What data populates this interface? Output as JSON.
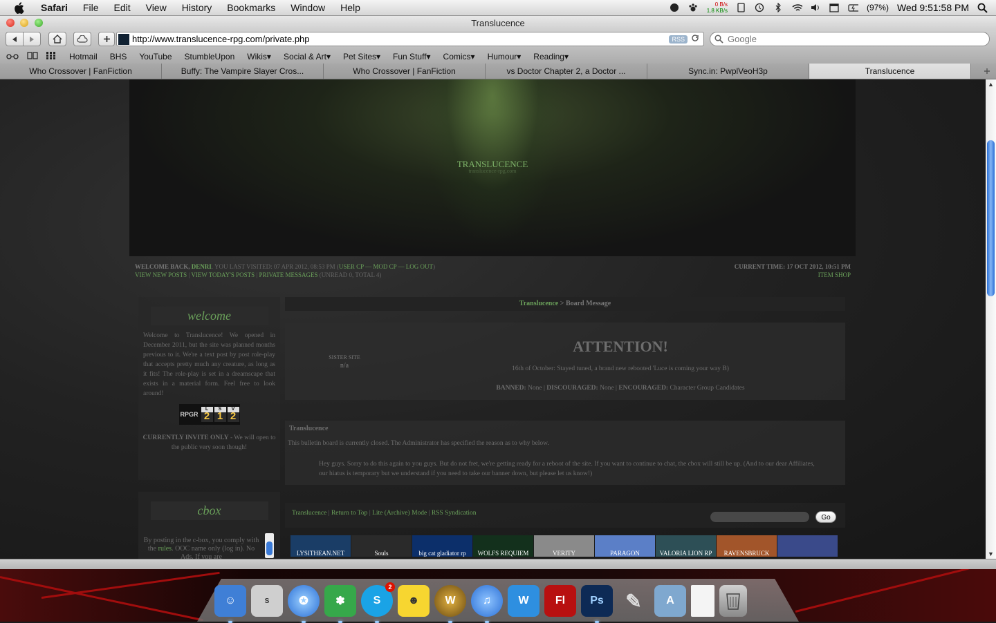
{
  "menubar": {
    "app": "Safari",
    "items": [
      "File",
      "Edit",
      "View",
      "History",
      "Bookmarks",
      "Window",
      "Help"
    ],
    "net_up": "0 B/s",
    "net_down": "1.8 KB/s",
    "battery": "(97%)",
    "clock": "Wed 9:51:58 PM"
  },
  "window": {
    "title": "Translucence"
  },
  "toolbar": {
    "url": "http://www.translucence-rpg.com/private.php",
    "rss_label": "RSS",
    "search_placeholder": "Google"
  },
  "bookmarks": [
    "Hotmail",
    "BHS",
    "YouTube",
    "StumbleUpon",
    "Wikis▾",
    "Social & Art▾",
    "Pet Sites▾",
    "Fun Stuff▾",
    "Comics▾",
    "Humour▾",
    "Reading▾"
  ],
  "tabs": [
    {
      "title": "Who Crossover | FanFiction"
    },
    {
      "title": "Buffy: The Vampire Slayer Cros..."
    },
    {
      "title": "Who Crossover | FanFiction"
    },
    {
      "title": "vs Doctor Chapter 2, a Doctor ..."
    },
    {
      "title": "Sync.in: PwplVeoH3p"
    },
    {
      "title": "Translucence"
    }
  ],
  "banner": {
    "name": "TRANSLUCENCE",
    "sub": "translucence-rpg.com"
  },
  "userbar": {
    "welcome_prefix": "WELCOME BACK,",
    "username": "DENRI",
    "visited": ". YOU LAST VISITED: 07 APR 2012, 08:53 PM (",
    "user_cp": "USER CP",
    "mod_cp": "MOD CP",
    "log_out": "LOG OUT",
    "close_paren": ")",
    "sep": " — ",
    "view_new": "VIEW NEW POSTS",
    "view_today": "VIEW TODAY'S POSTS",
    "pms": "PRIVATE MESSAGES",
    "pm_counts": " (UNREAD 0, TOTAL 4)",
    "pipe": " | ",
    "current_time": "CURRENT TIME: 17 OCT 2012, 10:51 PM",
    "item_shop": "ITEM SHOP"
  },
  "sidebar": {
    "welcome_title": "welcome",
    "welcome_text": "Welcome to Translucence! We opened in December 2011, but the site was planned months previous to it. We're a text post by post role-play that accepts pretty much any creature, as long as it fits! The role-play is set in a dreamscape that exists in a material form. Feel free to look around!",
    "rpgr_logo": "RPGR",
    "rpgr_digits": [
      {
        "k": "L",
        "v": "2"
      },
      {
        "k": "S",
        "v": "1"
      },
      {
        "k": "V",
        "v": "2"
      }
    ],
    "invite_bold": "CURRENTLY INVITE ONLY",
    "invite_rest": " - We will open to the public very soon though!",
    "cbox_title": "cbox",
    "cbox_text_1": "By posting in the c-box, you comply with the ",
    "cbox_rules": "rules",
    "cbox_text_2": ". OOC name only (log in). No Ads. If you are"
  },
  "breadcrumb": {
    "link": "Translucence",
    "rest": " > Board Message"
  },
  "attention": {
    "sister_label": "SISTER SITE",
    "sister_value": "n/a",
    "heading": "ATTENTION!",
    "message": "16th of October: Stayed tuned, a brand new rebooted 'Luce is coming your way B)",
    "banned_label": "BANNED:",
    "banned_value": " None | ",
    "discouraged_label": "DISCOURAGED:",
    "discouraged_value": " None | ",
    "encouraged_label": "ENCOURAGED:",
    "encouraged_value": " Character Group Candidates"
  },
  "closed": {
    "title": "Translucence",
    "line1": "This bulletin board is currently closed. The Administrator has specified the reason as to why below.",
    "line2": "Hey guys. Sorry to do this again to you guys. But do not fret, we're getting ready for a reboot of the site. If you want to continue to chat, the cbox will still be up. (And to our dear Affiliates, our hiatus is temporary but we understand if you need to take our banner down, but please let us know!)"
  },
  "footer": {
    "home": "Translucence",
    "top": "Return to Top",
    "lite": "Lite (Archive) Mode",
    "rss": "RSS Syndication",
    "sep": " | ",
    "go": "Go"
  },
  "affiliates": [
    {
      "label": "LYSITHEAN.NET",
      "color": "#1a3d66"
    },
    {
      "label": "Souls",
      "color": "#2a2a2a"
    },
    {
      "label": "big cat gladiator rp",
      "color": "#0c2f6a"
    },
    {
      "label": "WOLFS REQUIEM",
      "color": "#13301c"
    },
    {
      "label": "VERITY",
      "color": "#8a8a8a"
    },
    {
      "label": "PARAGON",
      "color": "#5b7fc7"
    },
    {
      "label": "VALORIA LION RP",
      "color": "#2d4f56"
    },
    {
      "label": "RAVENSBRUCK",
      "color": "#a2552a"
    },
    {
      "label": "",
      "color": "#3a4a8a"
    }
  ],
  "dock": [
    {
      "name": "finder-icon",
      "color": "#3f7fd6",
      "glyph": "☺"
    },
    {
      "name": "solution-menu-icon",
      "color": "#cfcfcf",
      "glyph": "S"
    },
    {
      "name": "safari-icon",
      "color": "#5aa0e6",
      "glyph": "✪"
    },
    {
      "name": "messenger-icon",
      "color": "#36a84a",
      "glyph": "✽"
    },
    {
      "name": "skype-icon",
      "color": "#1aa3e6",
      "glyph": "S",
      "badge": "2"
    },
    {
      "name": "smiley-app-icon",
      "color": "#f7d630",
      "glyph": "☻"
    },
    {
      "name": "warcraft-icon",
      "color": "#8a6a20",
      "glyph": "W"
    },
    {
      "name": "itunes-icon",
      "color": "#2a6fd6",
      "glyph": "♫"
    },
    {
      "name": "wl-icon",
      "color": "#2e8fe0",
      "glyph": "W"
    },
    {
      "name": "flash-icon",
      "color": "#b81010",
      "glyph": "Fl"
    },
    {
      "name": "photoshop-icon",
      "color": "#0d2a55",
      "glyph": "Ps"
    },
    {
      "name": "brush-icon",
      "color": "#777777",
      "glyph": "✎"
    },
    {
      "name": "applications-folder-icon",
      "color": "#7fa8cf",
      "glyph": "A"
    },
    {
      "name": "document-icon",
      "color": "#f4f4f4",
      "glyph": ""
    },
    {
      "name": "trash-icon",
      "color": "#9a9a9a",
      "glyph": "🗑"
    }
  ]
}
